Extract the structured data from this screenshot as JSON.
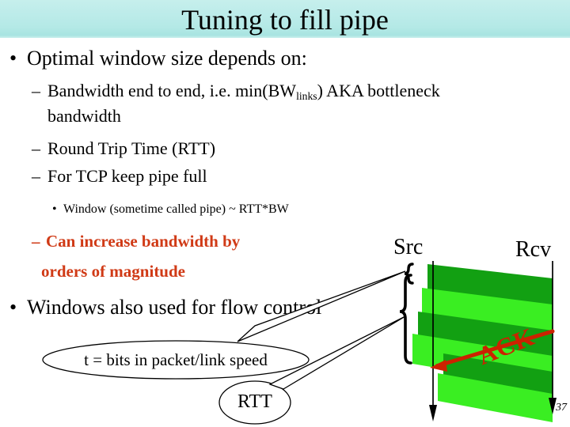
{
  "slide": {
    "title": "Tuning to fill pipe",
    "page_number": "37",
    "header_color": "#bdecea",
    "accent_red": "#d03a16",
    "ack_red": "#cc2200",
    "green_dark": "#12a012",
    "green_bright": "#3aee22"
  },
  "body": {
    "bullet_marker": "•",
    "dash_marker": "–",
    "b1": "Optimal window size depends on:",
    "b2a_pre": "Bandwidth end to end, i.e. min(BW",
    "b2a_sub": "links",
    "b2a_post": ") AKA bottleneck",
    "b2a_cont": "bandwidth",
    "b2b": "Round Trip Time (RTT)",
    "b2c": "For TCP keep pipe full",
    "b3a": "Window (sometime called pipe) ~ RTT*BW",
    "red1": "Can increase bandwidth by",
    "red2": "orders of magnitude",
    "b4": "Windows also used for flow control"
  },
  "diagram": {
    "src_label": "Src",
    "rcv_label": "Rcv",
    "ack_label": "ACK",
    "callout_t": "t = bits in packet/link speed",
    "callout_rtt": "RTT",
    "packet_bands": [
      {
        "shade": "dark"
      },
      {
        "shade": "bright"
      },
      {
        "shade": "dark"
      },
      {
        "shade": "bright"
      },
      {
        "shade": "dark"
      },
      {
        "shade": "bright"
      }
    ]
  }
}
